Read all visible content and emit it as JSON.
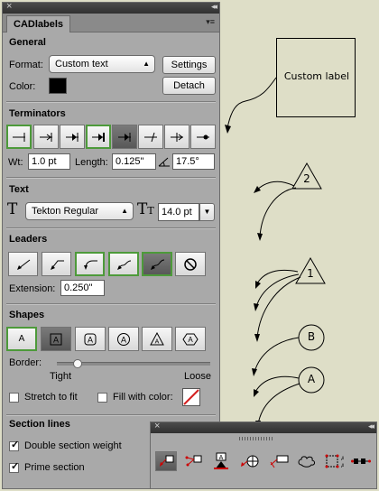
{
  "panel": {
    "tab_title": "CADlabels",
    "general": {
      "title": "General",
      "format_label": "Format:",
      "format_value": "Custom text",
      "settings_button": "Settings",
      "color_label": "Color:",
      "detach_button": "Detach"
    },
    "terminators": {
      "title": "Terminators",
      "wt_label": "Wt:",
      "wt_value": "1.0 pt",
      "length_label": "Length:",
      "length_value": "0.125\"",
      "angle_value": "17.5°"
    },
    "text": {
      "title": "Text",
      "font_value": "Tekton Regular",
      "size_value": "14.0 pt"
    },
    "leaders": {
      "title": "Leaders",
      "extension_label": "Extension:",
      "extension_value": "0.250\""
    },
    "shapes": {
      "title": "Shapes",
      "border_label": "Border:",
      "tight_label": "Tight",
      "loose_label": "Loose",
      "border_level": 0.1,
      "stretch_label": "Stretch to fit",
      "fill_label": "Fill with color:"
    },
    "section_lines": {
      "title": "Section lines",
      "double_weight_label": "Double section weight",
      "prime_section_label": "Prime section"
    }
  },
  "canvas": {
    "custom_label_text": "Custom label",
    "triangle_2": "2",
    "triangle_1": "1",
    "circle_b": "B",
    "circle_a": "A"
  },
  "colors": {
    "panel_bg": "#a9a9a9",
    "canvas_bg": "#dedec7",
    "selected_border": "#4d9a3a",
    "fill_none": "#d42020"
  }
}
